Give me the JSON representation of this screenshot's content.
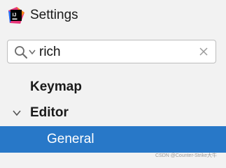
{
  "window": {
    "title": "Settings"
  },
  "search": {
    "value": "rich"
  },
  "tree": {
    "items": [
      {
        "label": "Keymap"
      },
      {
        "label": "Editor"
      },
      {
        "label": "General"
      }
    ]
  },
  "watermark": {
    "text": "CSDN @Counter-Strike大牛"
  },
  "colors": {
    "accent": "#2878c8",
    "background": "#f2f2f2",
    "logo_pink": "#e8357a",
    "logo_blue": "#1f6ff0",
    "logo_orange": "#ff8a18"
  }
}
